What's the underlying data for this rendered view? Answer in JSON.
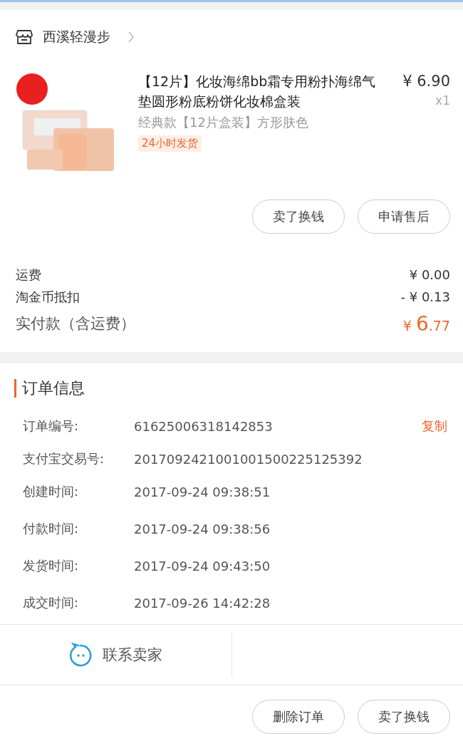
{
  "store": {
    "name": "西溪轻漫步"
  },
  "product": {
    "title": "【12片】化妆海绵bb霜专用粉扑海绵气垫圆形粉底粉饼化妆棉盒装",
    "price": "¥ 6.90",
    "quantity": "x1",
    "variant": "经典款【12片盒装】方形肤色",
    "tag": "24小时发货"
  },
  "item_actions": [
    "卖了换钱",
    "申请售后"
  ],
  "fees": [
    {
      "label": "运费",
      "value": "¥ 0.00"
    },
    {
      "label": "淘金币抵扣",
      "value": "- ¥ 0.13"
    }
  ],
  "total": {
    "label": "实付款（含运费）",
    "currency": "¥ ",
    "integer": "6",
    "decimal": ".77"
  },
  "order_info": {
    "title": "订单信息",
    "rows": [
      {
        "label": "订单编号:",
        "value": "61625006318142853",
        "action": "复制"
      },
      {
        "label": "支付宝交易号:",
        "value": "2017092421001001500225125392"
      },
      {
        "label": "创建时间:",
        "value": "2017-09-24 09:38:51"
      },
      {
        "label": "付款时间:",
        "value": "2017-09-24 09:38:56"
      },
      {
        "label": "发货时间:",
        "value": "2017-09-24 09:43:50"
      },
      {
        "label": "成交时间:",
        "value": "2017-09-26 14:42:28"
      }
    ]
  },
  "contact": {
    "label": "联系卖家"
  },
  "order_actions": [
    "删除订单",
    "卖了换钱"
  ]
}
